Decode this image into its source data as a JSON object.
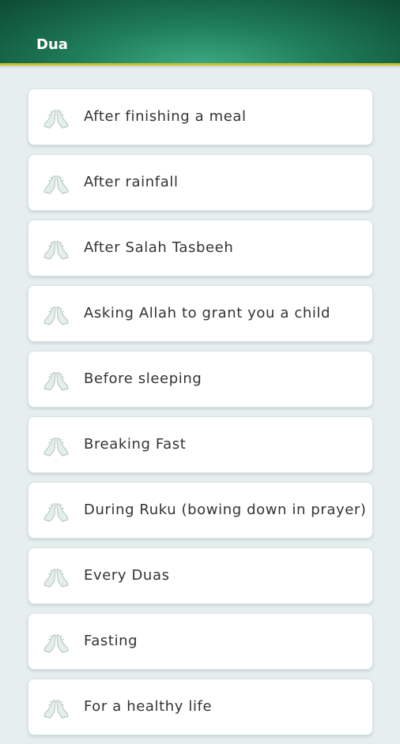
{
  "app_bar": {
    "title": "Dua",
    "gradient_colors": [
      "#3fae88",
      "#1f7d5a",
      "#0d4a32"
    ],
    "accent_line": "#c9c42a"
  },
  "list": {
    "icon": "praying-hands-icon",
    "items": [
      {
        "label": "After finishing a meal"
      },
      {
        "label": "After rainfall"
      },
      {
        "label": "After Salah Tasbeeh"
      },
      {
        "label": "Asking Allah to grant you a child"
      },
      {
        "label": "Before sleeping"
      },
      {
        "label": "Breaking Fast"
      },
      {
        "label": "During Ruku (bowing down in prayer)"
      },
      {
        "label": "Every Duas"
      },
      {
        "label": "Fasting"
      },
      {
        "label": "For a healthy life"
      }
    ]
  }
}
